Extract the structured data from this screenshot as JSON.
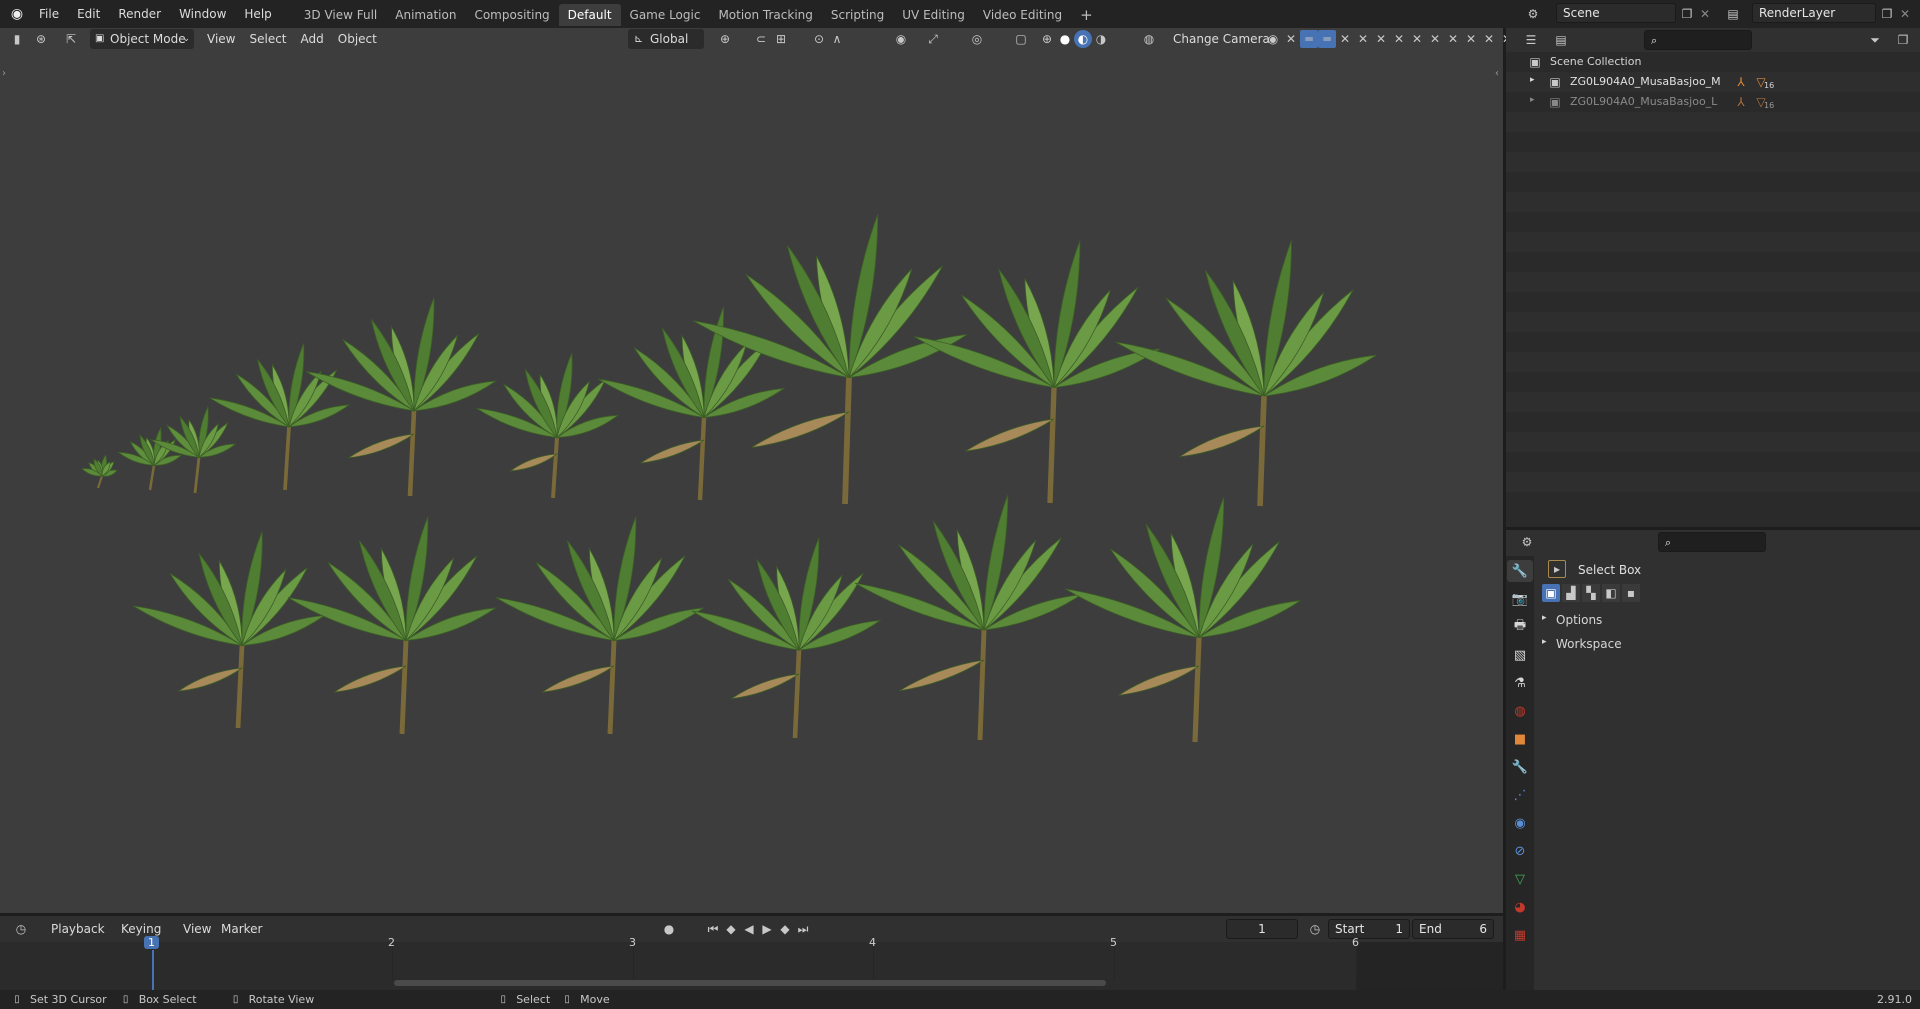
{
  "topbar": {
    "menus": [
      "File",
      "Edit",
      "Render",
      "Window",
      "Help"
    ],
    "workspaces": [
      "3D View Full",
      "Animation",
      "Compositing",
      "Default",
      "Game Logic",
      "Motion Tracking",
      "Scripting",
      "UV Editing",
      "Video Editing"
    ],
    "active_workspace": "Default",
    "add_label": "+",
    "scene_name": "Scene",
    "render_layer": "RenderLayer"
  },
  "viewport": {
    "mode": "Object Mode",
    "menus": [
      "View",
      "Select",
      "Add",
      "Object"
    ],
    "orientation": "Global",
    "change_camera": "Change Camera",
    "plant_count_row1": 10,
    "plant_count_row2": 6
  },
  "outliner": {
    "root": "Scene Collection",
    "items": [
      {
        "name": "ZG0L904A0_MusaBasjoo_M",
        "badge": "16",
        "dim": false
      },
      {
        "name": "ZG0L904A0_MusaBasjoo_L",
        "badge": "16",
        "dim": true
      }
    ]
  },
  "properties": {
    "tool_name": "Select Box",
    "sections": [
      "Options",
      "Workspace"
    ]
  },
  "timeline": {
    "menus": [
      "Playback",
      "Keying",
      "View",
      "Marker"
    ],
    "current_frame": "1",
    "start_label": "Start",
    "start_value": "1",
    "end_label": "End",
    "end_value": "6",
    "ticks": [
      "1",
      "2",
      "3",
      "4",
      "5",
      "6"
    ]
  },
  "statusbar": {
    "items": [
      "Set 3D Cursor",
      "Box Select",
      "Rotate View",
      "Select",
      "Move"
    ],
    "version": "2.91.0"
  },
  "colors": {
    "accent": "#4772b3",
    "viewport_bg": "#3d3d3d",
    "leaf_green": "#5a8a3a",
    "orange_icon": "#e0883a"
  }
}
